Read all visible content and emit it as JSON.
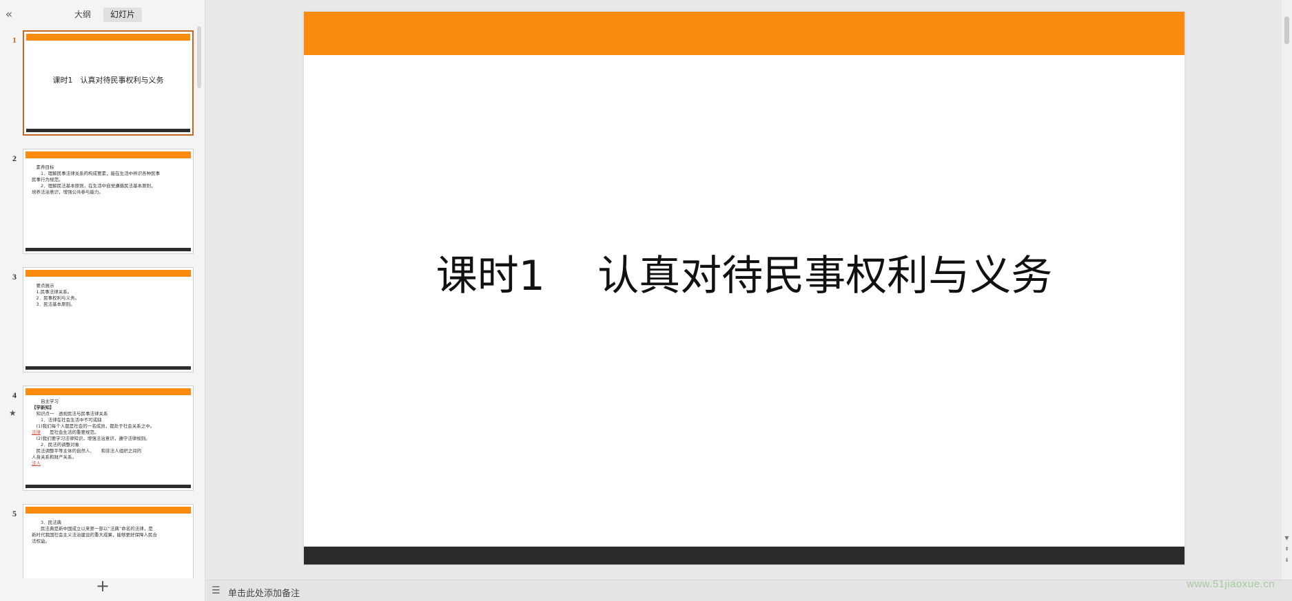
{
  "left_panel": {
    "collapse_icon": "«",
    "tabs": [
      {
        "label": "大纲",
        "active": false
      },
      {
        "label": "幻灯片",
        "active": true
      }
    ],
    "add_slide_icon": "+"
  },
  "slides": [
    {
      "num": "1",
      "title": "课时1　认真对待民事权利与义务",
      "lines": []
    },
    {
      "num": "2",
      "title": "",
      "lines": [
        "　素养目标",
        "　　1．理解民事法律关系的构成要素，能在生活中辨识各种民事",
        "民事行为规范。",
        "　　2．理解民法基本原则，在生活中自觉遵循民法基本原则，",
        "培养法治意识，增强公共参与能力。"
      ]
    },
    {
      "num": "3",
      "title": "",
      "lines": [
        "　要点展示",
        "　1.民事法律关系。",
        "　2．民事权利与义务。",
        "　3．民法基本原则。"
      ]
    },
    {
      "num": "4",
      "title": "",
      "star": "★",
      "lines": [
        "　　自主学习",
        "【学新知】",
        "　知识点一　透视民法与民事法律关系",
        "　　1．法律在社会生活中不可或缺",
        "　(1)我们每个人都是社会的一名成员，都处于社会关系之中。",
        "　　是社会生活的重要规范。",
        "　(2)我们要学习法律知识，增强法治意识，遵守法律规则。",
        "　　2．民法的调整对象",
        "　民法调整平等主体的自然人、　　和非法人组织之间的",
        "人身关系和财产关系。"
      ]
    },
    {
      "num": "5",
      "title": "",
      "lines": [
        "　　3．民法典",
        "　　民法典是新中国成立以来第一部以“法典”命名的法律，是",
        "新时代我国社会主义法治建设的重大成果，能够更好保障人民合",
        "法权益。"
      ]
    }
  ],
  "blanks": {
    "s4_blank1": "法律",
    "s4_blank2": "法人"
  },
  "main_slide": {
    "title": "课时1    认真对待民事权利与义务",
    "accent_color": "#fb8b0f",
    "footer_color": "#2b2b2b"
  },
  "notes": {
    "icon": "notes-icon",
    "placeholder": "单击此处添加备注"
  },
  "watermark": "www.51jiaoxue.cn"
}
